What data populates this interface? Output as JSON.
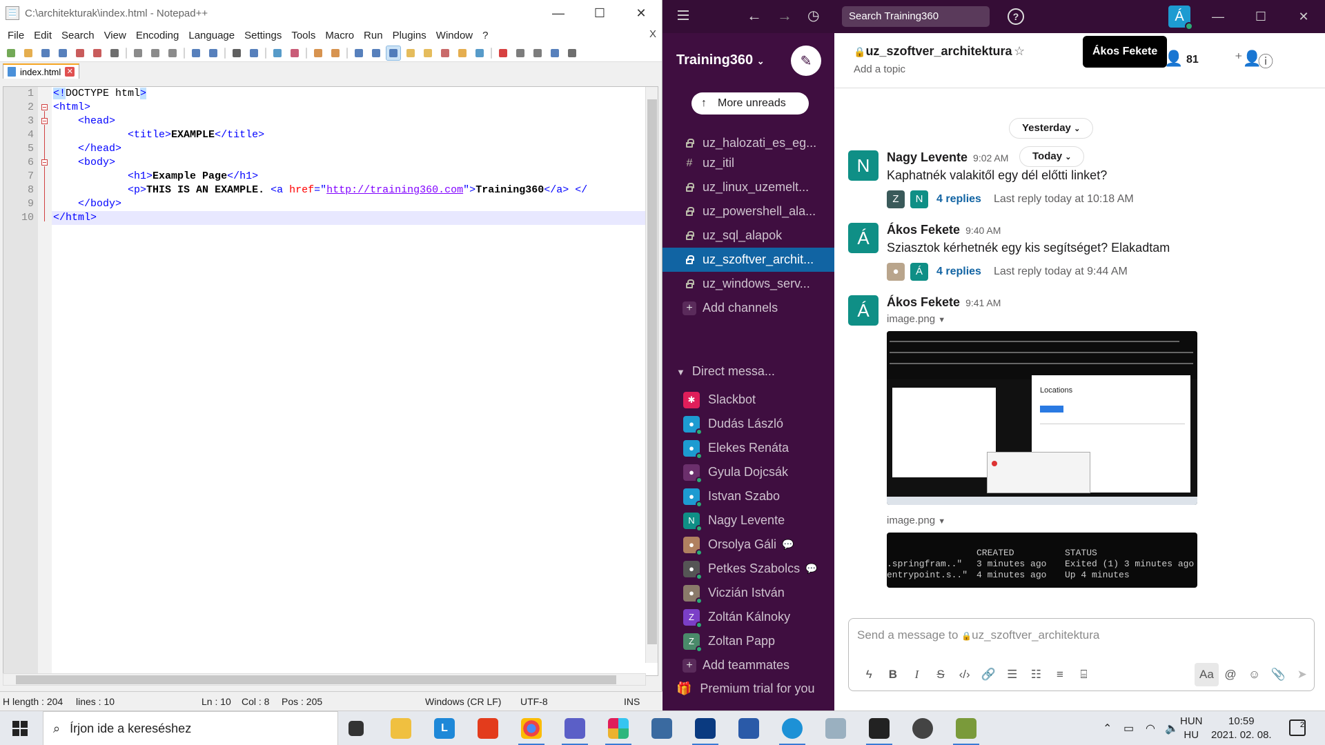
{
  "npp": {
    "title": "C:\\architekturak\\index.html - Notepad++",
    "menu": [
      "File",
      "Edit",
      "Search",
      "View",
      "Encoding",
      "Language",
      "Settings",
      "Tools",
      "Macro",
      "Run",
      "Plugins",
      "Window",
      "?"
    ],
    "close_x": "X",
    "tab_label": "index.html",
    "line_numbers": [
      "1",
      "2",
      "3",
      "4",
      "5",
      "6",
      "7",
      "8",
      "9",
      "10"
    ],
    "status": {
      "length": "H length : 204",
      "lines": "lines : 10",
      "ln": "Ln : 10",
      "col": "Col : 8",
      "pos": "Pos : 205",
      "eol": "Windows (CR LF)",
      "encoding": "UTF-8",
      "mode": "INS"
    },
    "code": {
      "l1a": "<!",
      "l1b": "DOCTYPE html",
      "l1c": ">",
      "l2": "<html>",
      "l3": "<head>",
      "l4_open": "<title>",
      "l4_text": "EXAMPLE",
      "l4_close": "</title>",
      "l5": "</head>",
      "l6": "<body>",
      "l7_open": "<h1>",
      "l7_text": "Example Page",
      "l7_close": "</h1>",
      "l8_p": "<p>",
      "l8_text": "THIS IS AN EXAMPLE. ",
      "l8_a": "<a ",
      "l8_attr": "href",
      "l8_eq": "=\"",
      "l8_url": "http://training360.com",
      "l8_q": "\">",
      "l8_link": "Training360",
      "l8_aclose": "</a>",
      "l8_end": " </",
      "l9": "</body>",
      "l10": "</html>"
    }
  },
  "slack": {
    "search": "Search Training360",
    "avatar_letter": "Á",
    "workspace": "Training360",
    "more_unreads": "More unreads",
    "channels": [
      {
        "prefix": "lock",
        "name": "uz_halozati_es_eg..."
      },
      {
        "prefix": "#",
        "name": "uz_itil"
      },
      {
        "prefix": "lock",
        "name": "uz_linux_uzemelt..."
      },
      {
        "prefix": "lock",
        "name": "uz_powershell_ala..."
      },
      {
        "prefix": "lock",
        "name": "uz_sql_alapok"
      },
      {
        "prefix": "lock",
        "name": "uz_szoftver_archit..."
      },
      {
        "prefix": "lock",
        "name": "uz_windows_serv..."
      }
    ],
    "add_channels": "Add channels",
    "dm_header": "Direct messa...",
    "dms": [
      {
        "name": "Slackbot",
        "color": "#e01e5a",
        "letter": ""
      },
      {
        "name": "Dudás László",
        "color": "#1d9bd1",
        "letter": ""
      },
      {
        "name": "Elekes Renáta",
        "color": "#1d9bd1",
        "letter": ""
      },
      {
        "name": "Gyula Dojcsák",
        "color": "#6b2f6c",
        "letter": ""
      },
      {
        "name": "Istvan Szabo",
        "color": "#1d9bd1",
        "letter": ""
      },
      {
        "name": "Nagy Levente",
        "color": "#0f8f86",
        "letter": "N"
      },
      {
        "name": "Orsolya Gáli",
        "color": "#b08060",
        "letter": ""
      },
      {
        "name": "Petkes Szabolcs",
        "color": "#555555",
        "letter": ""
      },
      {
        "name": "Viczián István",
        "color": "#8a7a6a",
        "letter": ""
      },
      {
        "name": "Zoltán Kálnoky",
        "color": "#7b3fc7",
        "letter": "Z"
      },
      {
        "name": "Zoltan Papp",
        "color": "#4a8a6a",
        "letter": "Z"
      }
    ],
    "add_teammates": "Add teammates",
    "premium": "Premium trial for you",
    "channel_title": "uz_szoftver_architektura",
    "topic": "Add a topic",
    "tooltip": "Ákos Fekete",
    "member_count": "81",
    "day_yesterday": "Yesterday",
    "day_today": "Today",
    "messages": [
      {
        "avatar": "N",
        "author": "Nagy Levente",
        "time": "9:02 AM",
        "text": "Kaphatnék valakitől egy dél előtti linket?",
        "replies": "4 replies",
        "last": "Last reply today at 10:18 AM",
        "ta1": "Z",
        "ta2": "N"
      },
      {
        "avatar": "Á",
        "author": "Ákos Fekete",
        "time": "9:40 AM",
        "text": "Sziasztok kérhetnék egy kis segítséget? Elakadtam",
        "replies": "4 replies",
        "last": "Last reply today at 9:44 AM",
        "ta2": "Á"
      },
      {
        "avatar": "Á",
        "author": "Ákos Fekete",
        "time": "9:41 AM",
        "file1": "image.png",
        "file2": "image.png"
      }
    ],
    "shot1_heading": "Locations",
    "shot2": {
      "col_created": "CREATED",
      "col_status": "STATUS",
      "row1_left": ".springfram..\"",
      "row1_created": "3 minutes ago",
      "row1_status": "Exited (1) 3 minutes ago",
      "row2_left": "entrypoint.s..\"",
      "row2_created": "4 minutes ago",
      "row2_status": "Up 4 minutes"
    },
    "composer_placeholder": "Send a message to ",
    "composer_channel": "uz_szoftver_architektura"
  },
  "taskbar": {
    "search": "Írjon ide a kereséshez",
    "lang1": "HUN",
    "lang2": "HU",
    "time": "10:59",
    "date": "2021. 02. 08.",
    "notif_count": "2"
  }
}
